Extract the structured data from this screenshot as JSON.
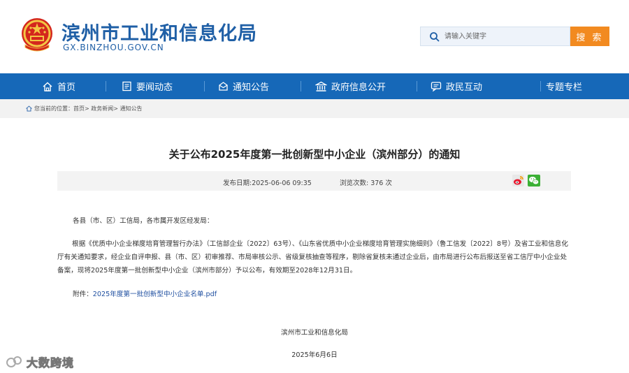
{
  "header": {
    "site_name": "滨州市工业和信息化局",
    "site_domain": "GX.BINZHOU.GOV.CN",
    "emblem_icon": "national-emblem-icon"
  },
  "search": {
    "placeholder": "请输入关键字",
    "button_label": "搜 索",
    "icon": "search-icon"
  },
  "nav": {
    "items": [
      {
        "label": "首页",
        "icon": "home-icon"
      },
      {
        "label": "要闻动态",
        "icon": "news-icon"
      },
      {
        "label": "通知公告",
        "icon": "notice-icon"
      },
      {
        "label": "政府信息公开",
        "icon": "government-building-icon"
      },
      {
        "label": "政民互动",
        "icon": "interaction-icon"
      },
      {
        "label": "专题专栏",
        "icon": ""
      }
    ]
  },
  "breadcrumb": {
    "prefix": "您当前的位置：",
    "path": "首页> 政务新闻> 通知公告"
  },
  "article": {
    "title": "关于公布2025年度第一批创新型中小企业（滨州部分）的通知",
    "publish_date": "发布日期:2025-06-06 09:35",
    "views": "浏览次数:   376   次",
    "greeting": "各县（市、区）工信局，各市属开发区经发局：",
    "body": "根据《优质中小企业梯度培育管理暂行办法》（工信部企业〔2022〕63号）、《山东省优质中小企业梯度培育管理实施细则》（鲁工信发〔2022〕8号）及省工业和信息化厅有关通知要求，经企业自评申报、县（市、区）初审推荐、市局审核公示、省级复核抽查等程序，剔除省复核未通过企业后，由市局进行公布后报送至省工信厅中小企业处备案，现将2025年度第一批创新型中小企业（滨州市部分）予以公布，有效期至2028年12月31日。",
    "attachment_label": "附件：",
    "attachment_link": "2025年度第一批创新型中小企业名单.pdf",
    "signature_org": "滨州市工业和信息化局",
    "signature_date": "2025年6月6日"
  },
  "share": {
    "weibo_icon": "weibo-icon",
    "wechat_icon": "wechat-icon"
  },
  "watermark": {
    "text": "大数跨境"
  },
  "colors": {
    "brand_blue": "#1668b8",
    "title_blue": "#1f5fa6",
    "search_orange": "#f28a20",
    "link_blue": "#1f4fa0"
  }
}
